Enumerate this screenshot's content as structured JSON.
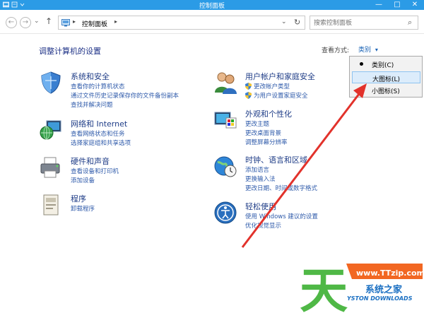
{
  "window": {
    "title": "控制面板",
    "minimize": "—",
    "maximize": "□",
    "close": "✕"
  },
  "nav": {
    "back": "←",
    "forward": "→",
    "dropdown": "⌄",
    "up": "↑",
    "breadcrumb": "控制面板",
    "breadcrumb_sep": "▸",
    "address_dropdown": "⌄",
    "refresh": "↻",
    "search_placeholder": "搜索控制面板",
    "search_icon": "⌕"
  },
  "heading": "调整计算机的设置",
  "view": {
    "label": "查看方式:",
    "value": "类别",
    "caret": "▾"
  },
  "categories": [
    {
      "title": "系统和安全",
      "links": [
        "查看你的计算机状态",
        "通过文件历史记录保存你的文件备份副本",
        "查找并解决问题"
      ]
    },
    {
      "title": "网络和 Internet",
      "links": [
        "查看网络状态和任务",
        "选择家庭组和共享选项"
      ]
    },
    {
      "title": "硬件和声音",
      "links": [
        "查看设备和打印机",
        "添加设备"
      ]
    },
    {
      "title": "程序",
      "links": [
        "卸载程序"
      ]
    },
    {
      "title": "用户帐户和家庭安全",
      "links": [
        "更改帐户类型",
        "为用户设置家庭安全"
      ]
    },
    {
      "title": "外观和个性化",
      "links": [
        "更改主题",
        "更改桌面背景",
        "调整屏幕分辨率"
      ]
    },
    {
      "title": "时钟、语言和区域",
      "links": [
        "添加语言",
        "更换输入法",
        "更改日期、时间或数字格式"
      ]
    },
    {
      "title": "轻松使用",
      "links": [
        "使用 Windows 建议的设置",
        "优化视觉显示"
      ]
    }
  ],
  "menu": {
    "items": [
      "类别(C)",
      "大图标(L)",
      "小图标(S)"
    ],
    "selected": 0,
    "highlighted": 1
  },
  "watermark": {
    "url": "www.TTzip.com",
    "site": "系统之家",
    "roman": "YSTON DOWNLOADS",
    "glyph": "天"
  },
  "colors": {
    "titlebar": "#2b9be6",
    "link": "#2e5aaa",
    "arrow": "#e2322b"
  }
}
